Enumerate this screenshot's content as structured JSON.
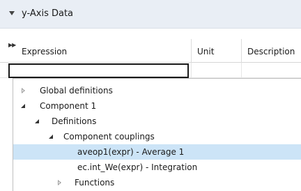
{
  "section": {
    "title": "y-Axis Data"
  },
  "table": {
    "columns": [
      "Expression",
      "Unit",
      "Description"
    ],
    "expression_value": ""
  },
  "tree": {
    "items": [
      {
        "label": "Global definitions",
        "state": "collapsed"
      },
      {
        "label": "Component 1",
        "state": "expanded"
      },
      {
        "label": "Definitions",
        "state": "expanded"
      },
      {
        "label": "Component couplings",
        "state": "expanded"
      },
      {
        "label": "aveop1(expr) - Average 1",
        "state": "leaf",
        "selected": true
      },
      {
        "label": "ec.int_We(expr) - Integration",
        "state": "leaf"
      },
      {
        "label": "Functions",
        "state": "collapsed"
      }
    ]
  },
  "colors": {
    "header_bg": "#e9eef5",
    "selection": "#cce4f7"
  }
}
